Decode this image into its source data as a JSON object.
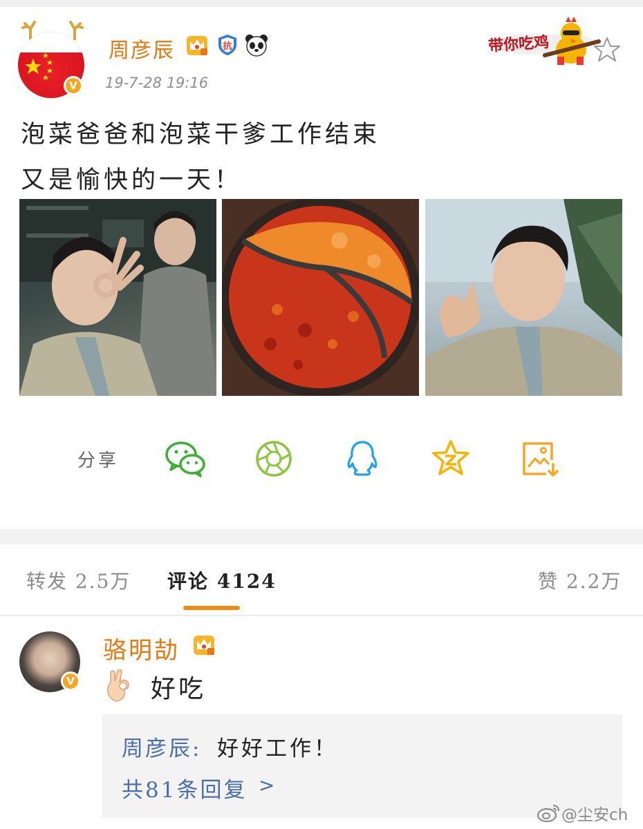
{
  "post": {
    "author": "周彦辰",
    "timestamp": "19-7-28 19:16",
    "text_line1": "泡菜爸爸和泡菜干爹工作结束",
    "text_line2": "又是愉快的一天！",
    "sticker_text": "带你吃鸡",
    "badge_shield_text": "抗",
    "verified_mark": "V"
  },
  "share": {
    "label": "分享",
    "icons": [
      "wechat-icon",
      "moments-icon",
      "qq-icon",
      "qzone-icon",
      "save-image-icon"
    ]
  },
  "tabs": {
    "repost": "转发 2.5万",
    "comments": "评论 4124",
    "likes": "赞 2.2万"
  },
  "comment": {
    "author": "骆明劼",
    "text": "好吃",
    "verified_mark": "V",
    "reply": {
      "author": "周彦辰:",
      "text": "好好工作！",
      "more": "共81条回复",
      "chevron": ">"
    }
  },
  "watermark": "@尘安ch",
  "colors": {
    "name_orange": "#e8770e",
    "link_blue": "#4a6fa8",
    "tab_accent": "#f08a12",
    "wechat_green": "#3cb034",
    "moments_green": "#8cc63f",
    "qq_blue": "#1da1f2",
    "qzone_yellow": "#f5b400",
    "save_orange": "#f5a623"
  }
}
